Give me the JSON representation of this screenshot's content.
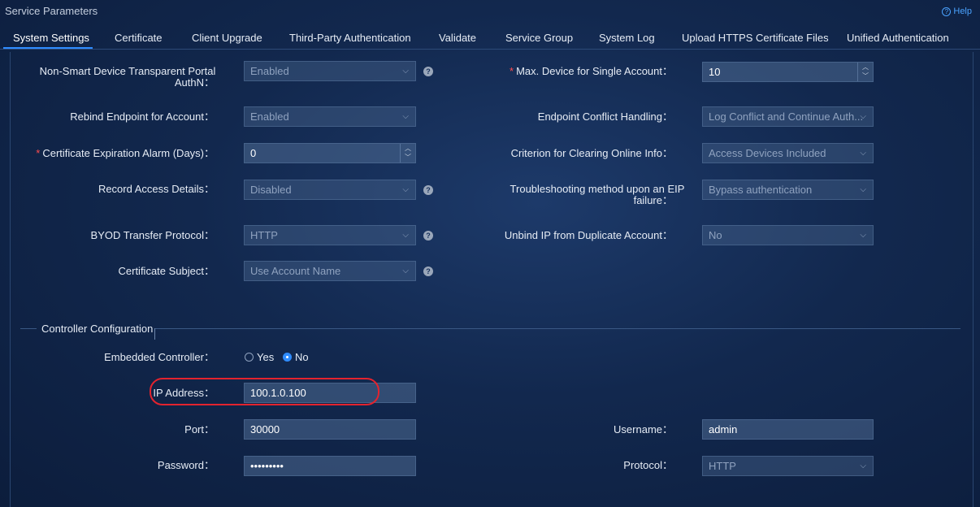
{
  "header": {
    "title": "Service Parameters",
    "help_label": "Help"
  },
  "tabs": [
    {
      "label": "System Settings",
      "active": true
    },
    {
      "label": "Certificate"
    },
    {
      "label": "Client Upgrade"
    },
    {
      "label": "Third-Party Authentication"
    },
    {
      "label": "Validate"
    },
    {
      "label": "Service Group"
    },
    {
      "label": "System Log"
    },
    {
      "label": "Upload HTTPS Certificate Files"
    },
    {
      "label": "Unified Authentication"
    }
  ],
  "left_fields": {
    "non_smart": {
      "label_line1": "Non-Smart Device Transparent Portal",
      "label_line2": "AuthN：",
      "value": "Enabled"
    },
    "rebind": {
      "label": "Rebind Endpoint for Account：",
      "value": "Enabled"
    },
    "cert_alarm": {
      "label": "Certificate Expiration Alarm (Days)：",
      "value": "0"
    },
    "record_access": {
      "label": "Record Access Details：",
      "value": "Disabled"
    },
    "byod": {
      "label": "BYOD Transfer Protocol：",
      "value": "HTTP"
    },
    "cert_subject": {
      "label": "Certificate Subject：",
      "value": "Use Account Name"
    }
  },
  "right_fields": {
    "max_device": {
      "label": "Max. Device for Single Account：",
      "value": "10"
    },
    "conflict": {
      "label": "Endpoint Conflict Handling：",
      "value": "Log Conflict and Continue Auth..."
    },
    "clearing": {
      "label": "Criterion for Clearing Online Info：",
      "value": "Access Devices Included"
    },
    "eip": {
      "label_line1": "Troubleshooting method upon an EIP",
      "label_line2": "failure：",
      "value": "Bypass authentication"
    },
    "unbind": {
      "label": "Unbind IP from Duplicate Account：",
      "value": "No"
    }
  },
  "controller": {
    "section_title": "Controller Configuration",
    "embedded_label": "Embedded Controller：",
    "yes_label": "Yes",
    "no_label": "No",
    "selected": "No",
    "ip_label": "IP Address：",
    "ip_value": "100.1.0.100",
    "port_label": "Port：",
    "port_value": "30000",
    "username_label": "Username：",
    "username_value": "admin",
    "password_label": "Password：",
    "password_value": "•••••••••",
    "protocol_label": "Protocol：",
    "protocol_value": "HTTP"
  },
  "icons": {
    "help": "question-circle-icon",
    "dropdown": "chevron-down-icon",
    "tooltip": "question-icon"
  },
  "colors": {
    "accent": "#2f8cff",
    "highlight": "#e3232e",
    "required": "#ff4d4f"
  }
}
